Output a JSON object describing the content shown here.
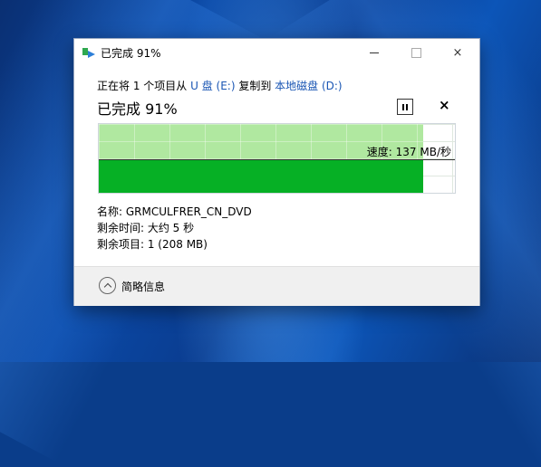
{
  "window": {
    "title": "已完成 91%",
    "controls": {
      "minimize": "minimize-icon",
      "maximize": "maximize-icon",
      "close": "×"
    }
  },
  "status": {
    "prefix": "正在将 1 个项目从 ",
    "source": "U 盘 (E:)",
    "middle": " 复制到 ",
    "destination": "本地磁盘 (D:)"
  },
  "progress": {
    "heading": "已完成 91%",
    "percent": 91,
    "speed_label": "速度: 137 MB/秒",
    "pause_icon": "pause-icon",
    "cancel_label": "×"
  },
  "details": {
    "name": "名称: GRMCULFRER_CN_DVD",
    "time_remaining": "剩余时间: 大约 5 秒",
    "items_remaining": "剩余项目: 1 (208 MB)"
  },
  "footer": {
    "toggle_icon": "chevron-up-icon",
    "label": "简略信息"
  },
  "colors": {
    "progress_fill": "#b0e8a0",
    "speed_area": "#06b025",
    "link": "#1a56b4"
  }
}
